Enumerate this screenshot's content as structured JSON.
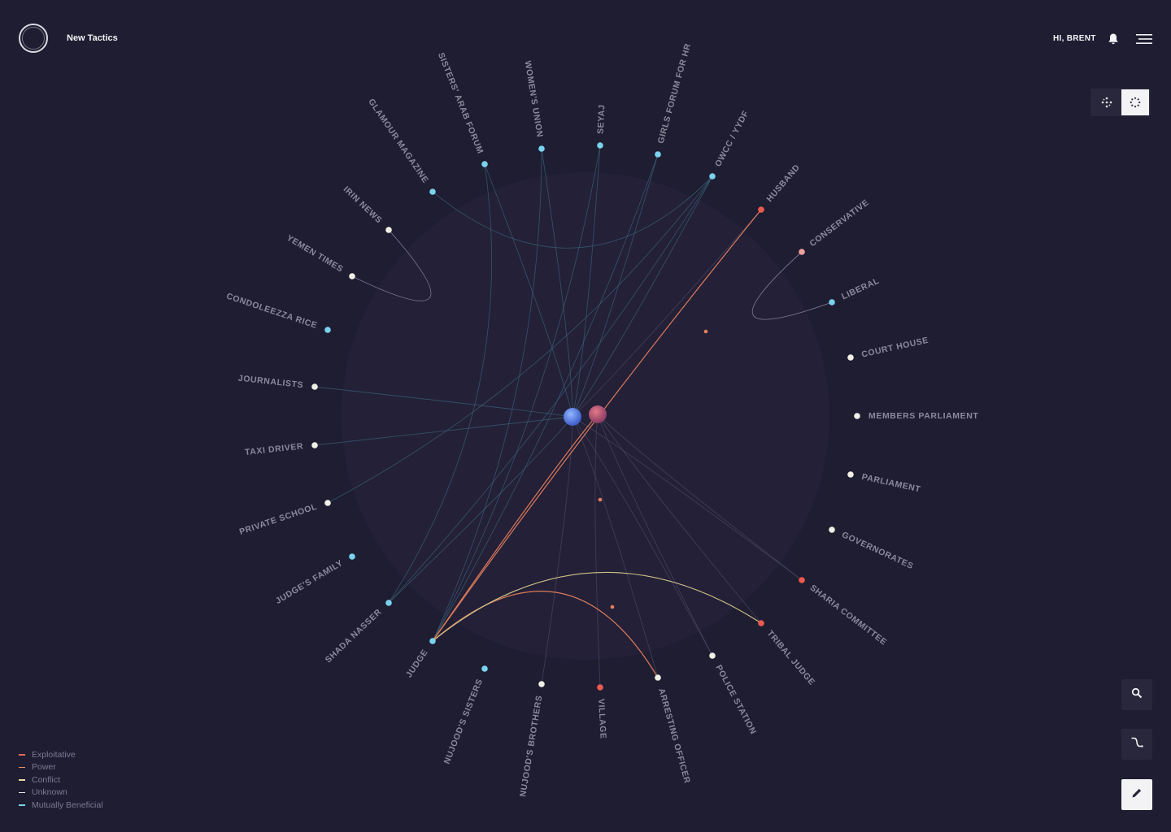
{
  "header": {
    "app_title": "New Tactics",
    "greeting": "HI, BRENT",
    "bell_icon": "bell-icon",
    "menu_icon": "hamburger-menu-icon"
  },
  "view_toggle": {
    "options": [
      {
        "icon": "scatter-layout-icon",
        "active": false
      },
      {
        "icon": "circle-layout-icon",
        "active": true
      }
    ]
  },
  "actions": [
    {
      "icon": "search-icon"
    },
    {
      "icon": "connector-icon"
    },
    {
      "icon": "pencil-icon"
    }
  ],
  "legend": {
    "items": [
      {
        "label": "Exploitative",
        "color": "#e8665a"
      },
      {
        "label": "Power",
        "color": "#e8906a"
      },
      {
        "label": "Conflict",
        "color": "#e6d9a0"
      },
      {
        "label": "Unknown",
        "color": "#e8e8ee"
      },
      {
        "label": "Mutually Beneficial",
        "color": "#7ad3ee"
      }
    ]
  },
  "colors": {
    "background": "#1f1d31",
    "node_blue": "#7ad3ee",
    "node_white": "#f1f0e6",
    "node_red": "#ee5a4f",
    "node_pink": "#f0a09a",
    "edge_teal": "#3a5f73",
    "edge_orange": "#e8805a",
    "edge_yellow": "#d9c98a",
    "edge_purple": "#4b4560"
  },
  "graph": {
    "nodes": [
      {
        "id": "husband",
        "label": "HUSBAND",
        "color": "red"
      },
      {
        "id": "conservative",
        "label": "CONSERVATIVE",
        "color": "pink"
      },
      {
        "id": "liberal",
        "label": "LIBERAL",
        "color": "blue"
      },
      {
        "id": "courthouse",
        "label": "COURT HOUSE",
        "color": "white"
      },
      {
        "id": "members",
        "label": "MEMBERS PARLIAMENT",
        "color": "white"
      },
      {
        "id": "parliament",
        "label": "PARLIAMENT",
        "color": "white"
      },
      {
        "id": "governorates",
        "label": "GOVERNORATES",
        "color": "white"
      },
      {
        "id": "sharia",
        "label": "SHARIA COMMITTEE",
        "color": "red"
      },
      {
        "id": "tribal",
        "label": "TRIBAL JUDGE",
        "color": "red"
      },
      {
        "id": "police",
        "label": "POLICE STATION",
        "color": "white"
      },
      {
        "id": "arresting",
        "label": "ARRESTING OFFICER",
        "color": "white"
      },
      {
        "id": "village",
        "label": "VILLAGE",
        "color": "red"
      },
      {
        "id": "brothers",
        "label": "NUJOOD'S BROTHERS",
        "color": "white"
      },
      {
        "id": "sisters",
        "label": "NUJOOD'S SISTERS",
        "color": "blue"
      },
      {
        "id": "judge",
        "label": "JUDGE",
        "color": "blue"
      },
      {
        "id": "shada",
        "label": "SHADA NASSER",
        "color": "blue"
      },
      {
        "id": "judgesfamily",
        "label": "JUDGE'S FAMILY",
        "color": "blue"
      },
      {
        "id": "privateschool",
        "label": "PRIVATE SCHOOL",
        "color": "white"
      },
      {
        "id": "taxi",
        "label": "TAXI DRIVER",
        "color": "white"
      },
      {
        "id": "journalists",
        "label": "JOURNALISTS",
        "color": "white"
      },
      {
        "id": "condoleezza",
        "label": "CONDOLEEZZA RICE",
        "color": "blue"
      },
      {
        "id": "yementimes",
        "label": "YEMEN TIMES",
        "color": "white"
      },
      {
        "id": "irin",
        "label": "IRIN NEWS",
        "color": "white"
      },
      {
        "id": "glamour",
        "label": "GLAMOUR MAGAZINE",
        "color": "blue"
      },
      {
        "id": "sistersarab",
        "label": "SISTERS' ARAB FORUM",
        "color": "blue"
      },
      {
        "id": "womensunion",
        "label": "WOMEN'S UNION",
        "color": "blue"
      },
      {
        "id": "seyaj",
        "label": "SEYAJ",
        "color": "blue"
      },
      {
        "id": "girlsforum",
        "label": "GIRLS FORUM FOR HR",
        "color": "blue"
      },
      {
        "id": "owcc",
        "label": "OWCC / YYDF",
        "color": "blue"
      }
    ],
    "centers": [
      {
        "id": "c1",
        "color": "blue"
      },
      {
        "id": "c2",
        "color": "red"
      }
    ]
  }
}
